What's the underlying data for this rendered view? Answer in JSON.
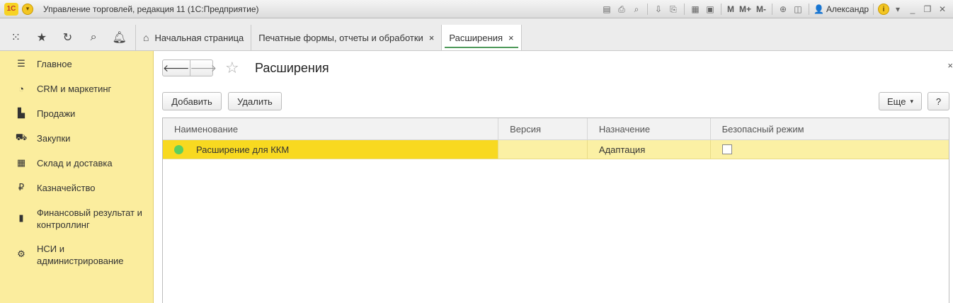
{
  "window": {
    "logo": "1С",
    "title": "Управление торговлей, редакция 11  (1С:Предприятие)",
    "user": "Александр",
    "toolbar_text": [
      "M",
      "M+",
      "M-"
    ]
  },
  "tabs": [
    {
      "label": "Начальная страница"
    },
    {
      "label": "Печатные формы, отчеты и обработки"
    },
    {
      "label": "Расширения"
    }
  ],
  "tab_close": "×",
  "sidebar": {
    "items": [
      {
        "label": "Главное",
        "icon": "menu-icon"
      },
      {
        "label": "CRM и маркетинг",
        "icon": "pie-chart-icon"
      },
      {
        "label": "Продажи",
        "icon": "bag-icon"
      },
      {
        "label": "Закупки",
        "icon": "cart-icon"
      },
      {
        "label": "Склад и доставка",
        "icon": "grid-icon"
      },
      {
        "label": "Казначейство",
        "icon": "ruble-icon"
      },
      {
        "label": "Финансовый результат и контроллинг",
        "icon": "bar-chart-icon"
      },
      {
        "label": "НСИ и администрирование",
        "icon": "gear-icon"
      }
    ]
  },
  "page": {
    "title": "Расширения",
    "close": "×"
  },
  "buttons": {
    "add": "Добавить",
    "delete": "Удалить",
    "more": "Еще",
    "help": "?"
  },
  "table": {
    "columns": [
      "Наименование",
      "Версия",
      "Назначение",
      "Безопасный режим"
    ],
    "rows": [
      {
        "name": "Расширение для ККМ",
        "version": "",
        "purpose": "Адаптация",
        "safe_mode": false
      }
    ]
  },
  "colors": {
    "sidebar": "#fbed9e",
    "selected_row": "#fbf0a4",
    "selected_cell": "#f8d920",
    "status_dot": "#5ccf5f"
  }
}
